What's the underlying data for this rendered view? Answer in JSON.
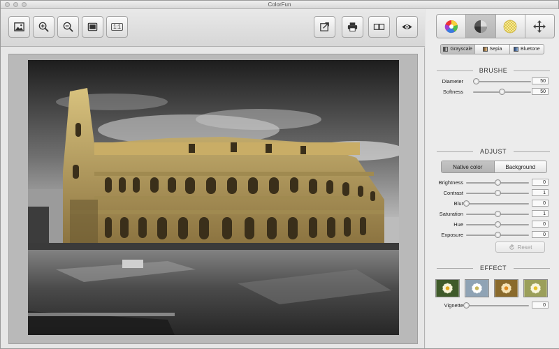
{
  "window": {
    "title": "ColorFun"
  },
  "toolbar": {
    "buttons": [
      {
        "icon": "open-image-icon"
      },
      {
        "icon": "zoom-in-icon"
      },
      {
        "icon": "zoom-out-icon"
      },
      {
        "icon": "fit-screen-icon"
      },
      {
        "icon": "actual-size-icon",
        "label": "1:1"
      },
      {
        "icon": "export-icon"
      },
      {
        "icon": "print-icon"
      },
      {
        "icon": "compare-icon"
      },
      {
        "icon": "eye-icon"
      }
    ]
  },
  "panel": {
    "tabs": [
      {
        "icon": "color-wheel-icon",
        "active": false
      },
      {
        "icon": "grayscale-wheel-icon",
        "active": true
      },
      {
        "icon": "pattern-icon",
        "active": false
      },
      {
        "icon": "move-arrows-icon",
        "active": false
      }
    ],
    "modes": [
      {
        "label": "Grayscale",
        "color": "#777777",
        "active": true
      },
      {
        "label": "Sepia",
        "color": "#b8864a",
        "active": false
      },
      {
        "label": "Bluetone",
        "color": "#3d5f8f",
        "active": false
      }
    ],
    "brushe": {
      "title": "BRUSHE",
      "diameter": {
        "label": "Diameter",
        "value": "50",
        "level": 0.05
      },
      "softness": {
        "label": "Softness",
        "value": "50",
        "level": 0.5
      }
    },
    "adjust": {
      "title": "ADJUST",
      "tabs": {
        "native": "Native color",
        "background": "Background"
      },
      "brightness": {
        "label": "Brightness",
        "value": "0",
        "level": 0.5
      },
      "contrast": {
        "label": "Contrast",
        "value": "1",
        "level": 0.5
      },
      "blur": {
        "label": "Blur",
        "value": "0",
        "level": 0.0
      },
      "saturation": {
        "label": "Saturation",
        "value": "1",
        "level": 0.5
      },
      "hue": {
        "label": "Hue",
        "value": "0",
        "level": 0.5
      },
      "exposure": {
        "label": "Exposure",
        "value": "0",
        "level": 0.5
      },
      "reset_label": "Reset"
    },
    "effect": {
      "title": "EFFECT",
      "thumbnails": [
        "effect-1",
        "effect-2",
        "effect-3",
        "effect-4"
      ],
      "vignette": {
        "label": "Vignette",
        "value": "0",
        "level": 0.0
      }
    }
  }
}
